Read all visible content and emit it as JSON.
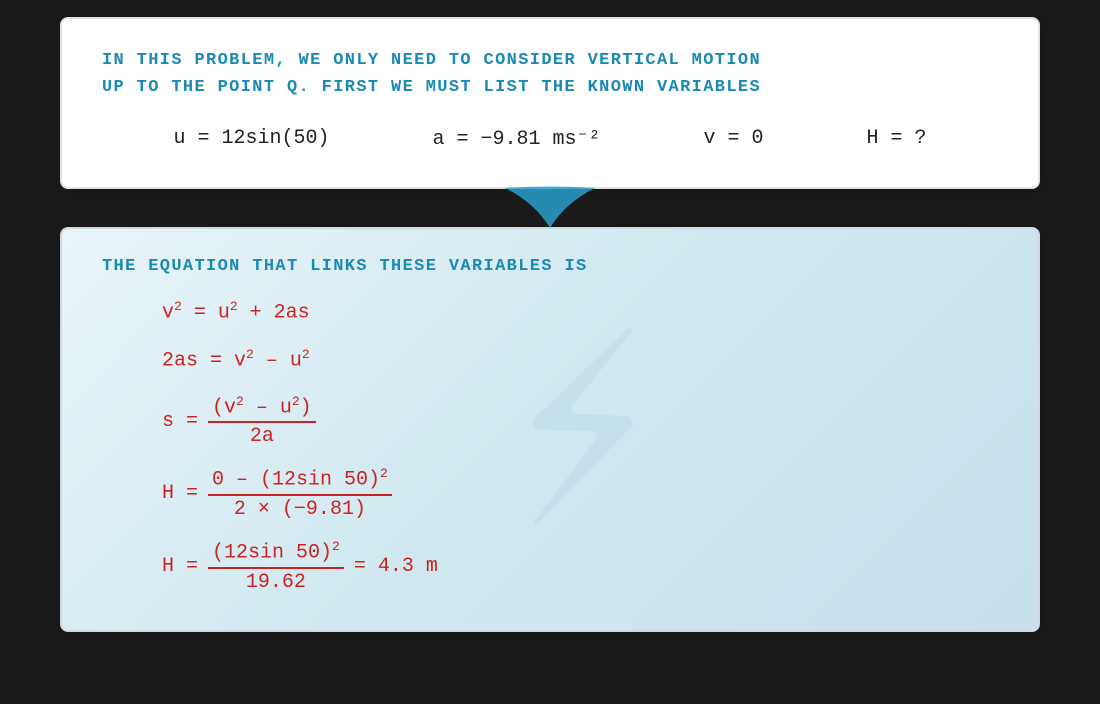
{
  "top_card": {
    "line1": "IN  THIS  PROBLEM,  WE  ONLY  NEED  TO  CONSIDER  VERTICAL  MOTION",
    "line2": "UP  TO  THE  POINT  Q.  FIRST  WE  MUST  LIST  THE  KNOWN  VARIABLES",
    "vars": {
      "u": "u = 12sin(50)",
      "a": "a = −9.81 ms⁻²",
      "v": "v = 0",
      "H": "H = ?"
    }
  },
  "bottom_card": {
    "header": "THE  EQUATION  THAT  LINKS  THESE  VARIABLES  IS",
    "eq1": "v² = u² + 2as",
    "eq2": "2as = v² – u²",
    "eq3_label": "s =",
    "eq3_num": "(v² – u²)",
    "eq3_den": "2a",
    "eq4_label": "H =",
    "eq4_num": "0 – (12sin 50)²",
    "eq4_den": "2 × (−9.81)",
    "eq5_label": "H =",
    "eq5_num": "(12sin 50)²",
    "eq5_den": "19.62",
    "eq5_result": "= 4.3 m"
  },
  "colors": {
    "blue": "#1a8ab5",
    "red": "#cc2222"
  }
}
